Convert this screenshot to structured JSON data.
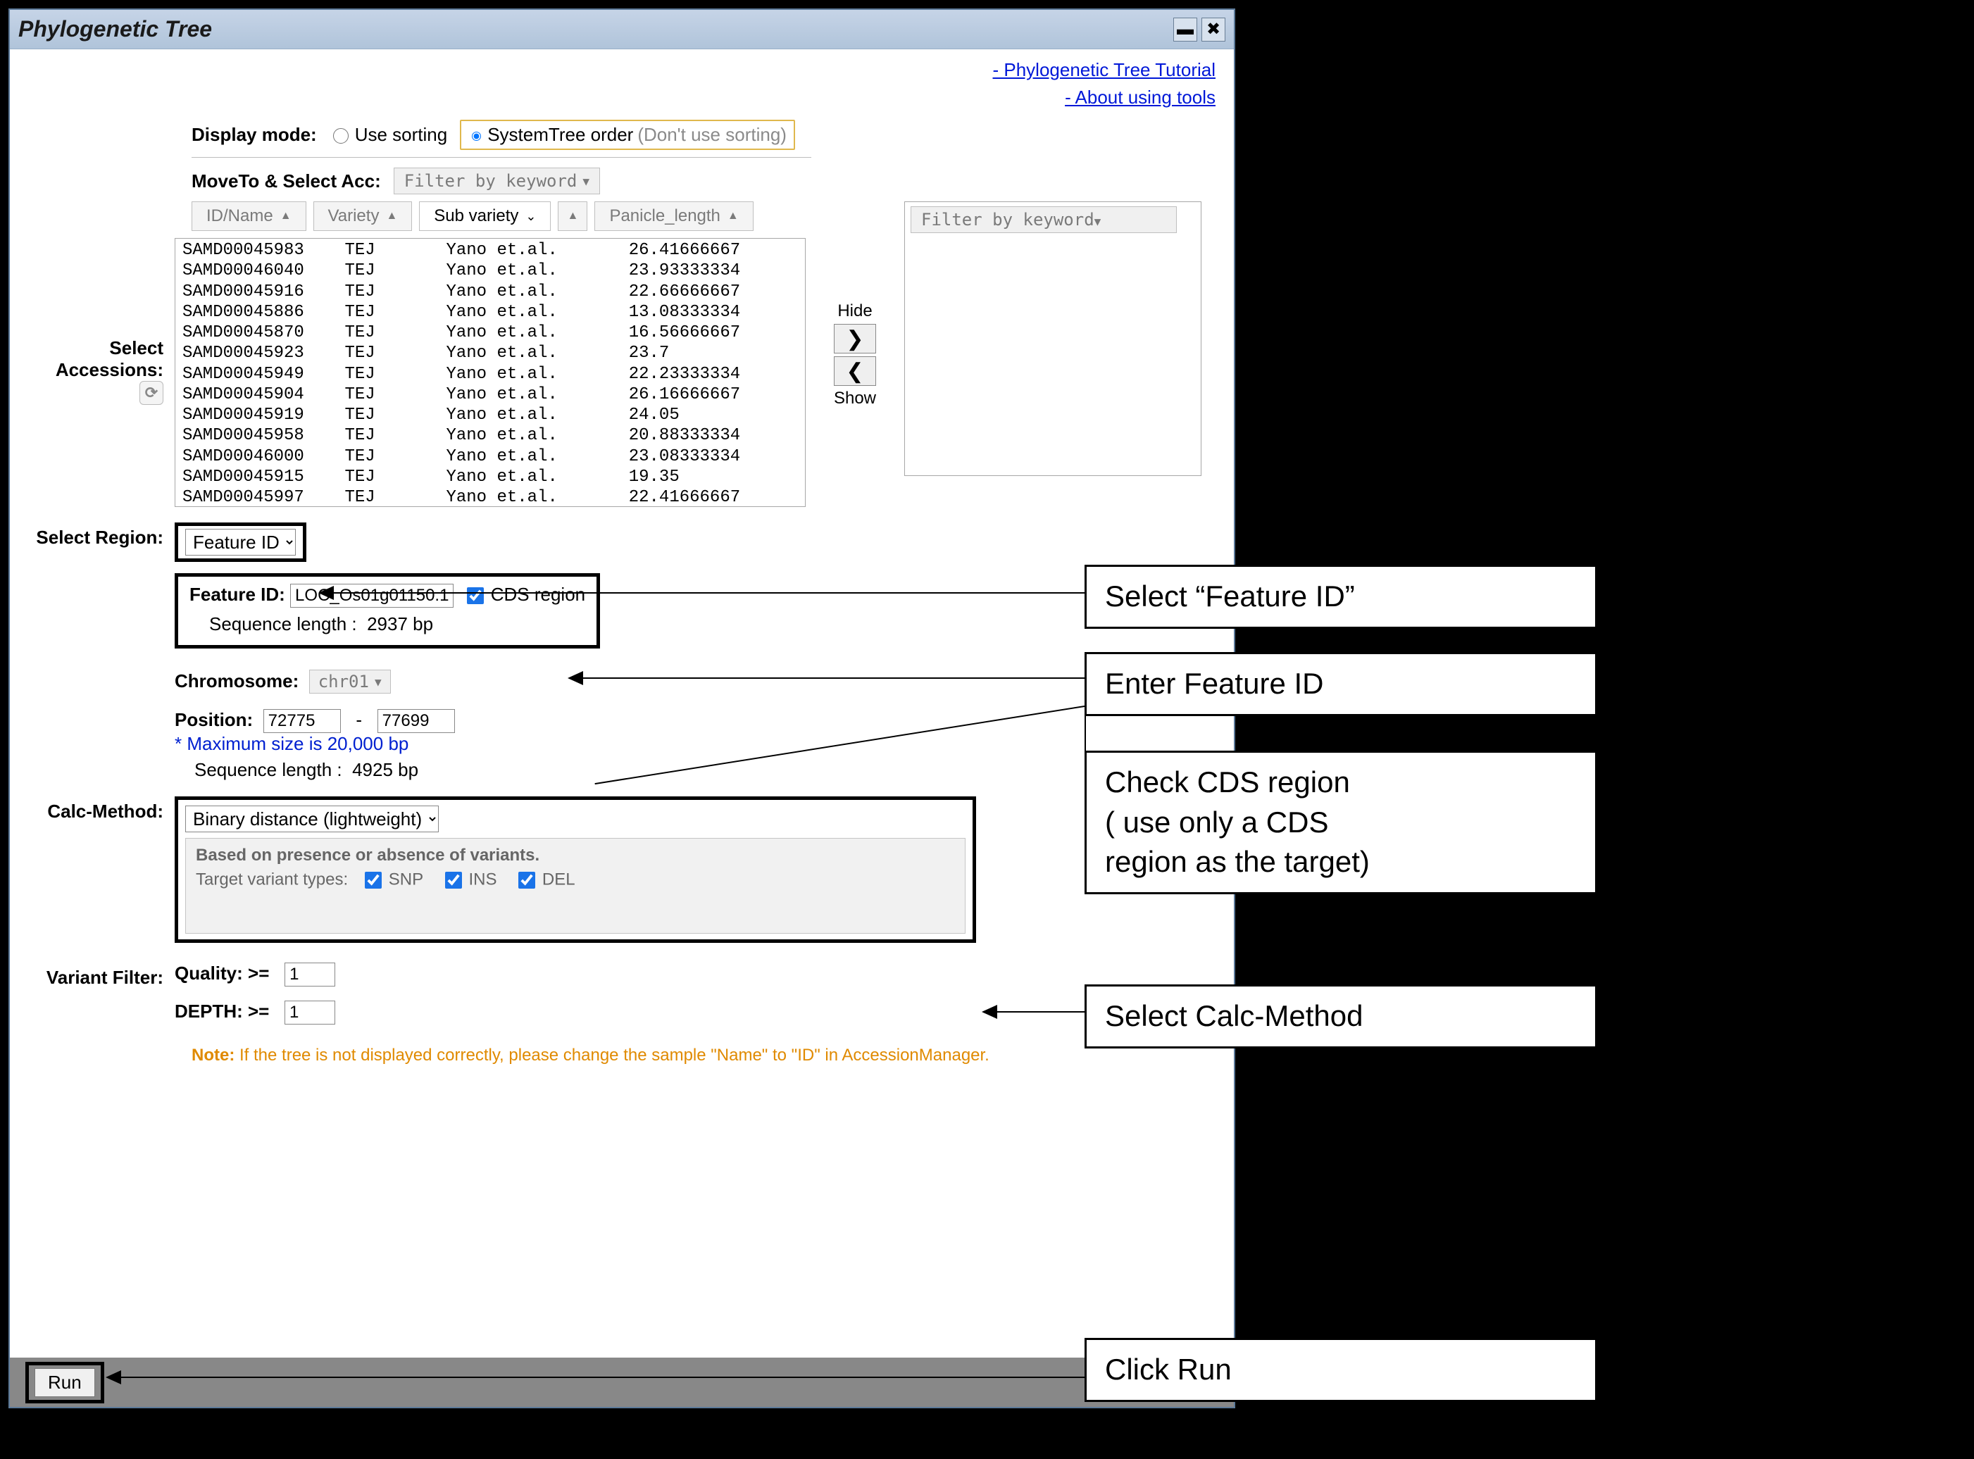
{
  "window": {
    "title": "Phylogenetic Tree"
  },
  "links": {
    "tutorial": "- Phylogenetic Tree Tutorial",
    "about": "- About using tools"
  },
  "display_mode": {
    "label": "Display mode:",
    "use_sorting": "Use sorting",
    "system_tree": "SystemTree order",
    "system_tree_hint": "(Don't use sorting)",
    "selected": "system_tree"
  },
  "moveto": {
    "label": "MoveTo & Select Acc:",
    "filter_placeholder": "Filter by keyword"
  },
  "accessions": {
    "section_label": "Select\nAccessions:",
    "columns": [
      {
        "name": "id",
        "label": "ID/Name",
        "active": false
      },
      {
        "name": "variety",
        "label": "Variety",
        "active": false
      },
      {
        "name": "subvariety",
        "label": "Sub variety",
        "active": true
      },
      {
        "name": "panicle",
        "label": "Panicle_length",
        "active": false
      }
    ],
    "rows": [
      {
        "id": "SAMD00045983",
        "variety": "TEJ",
        "sub": "Yano et.al.",
        "pl": "26.41666667"
      },
      {
        "id": "SAMD00046040",
        "variety": "TEJ",
        "sub": "Yano et.al.",
        "pl": "23.93333334"
      },
      {
        "id": "SAMD00045916",
        "variety": "TEJ",
        "sub": "Yano et.al.",
        "pl": "22.66666667"
      },
      {
        "id": "SAMD00045886",
        "variety": "TEJ",
        "sub": "Yano et.al.",
        "pl": "13.08333334"
      },
      {
        "id": "SAMD00045870",
        "variety": "TEJ",
        "sub": "Yano et.al.",
        "pl": "16.56666667"
      },
      {
        "id": "SAMD00045923",
        "variety": "TEJ",
        "sub": "Yano et.al.",
        "pl": "23.7"
      },
      {
        "id": "SAMD00045949",
        "variety": "TEJ",
        "sub": "Yano et.al.",
        "pl": "22.23333334"
      },
      {
        "id": "SAMD00045904",
        "variety": "TEJ",
        "sub": "Yano et.al.",
        "pl": "26.16666667"
      },
      {
        "id": "SAMD00045919",
        "variety": "TEJ",
        "sub": "Yano et.al.",
        "pl": "24.05"
      },
      {
        "id": "SAMD00045958",
        "variety": "TEJ",
        "sub": "Yano et.al.",
        "pl": "20.88333334"
      },
      {
        "id": "SAMD00046000",
        "variety": "TEJ",
        "sub": "Yano et.al.",
        "pl": "23.08333334"
      },
      {
        "id": "SAMD00045915",
        "variety": "TEJ",
        "sub": "Yano et.al.",
        "pl": "19.35"
      },
      {
        "id": "SAMD00045997",
        "variety": "TEJ",
        "sub": "Yano et.al.",
        "pl": "22.41666667"
      }
    ],
    "hide_label": "Hide",
    "show_label": "Show",
    "right_filter_placeholder": "Filter by keyword"
  },
  "region": {
    "section_label": "Select Region:",
    "mode_value": "Feature ID",
    "feature_id_label": "Feature ID:",
    "feature_id_value": "LOC_Os01g01150.1",
    "cds_label": "CDS region",
    "seq_len_label": "Sequence length :",
    "seq_len_value": "2937 bp",
    "chrom_label": "Chromosome:",
    "chrom_value": "chr01",
    "pos_label": "Position:",
    "pos_from": "72775",
    "pos_to": "77699",
    "pos_note": "* Maximum size is 20,000 bp",
    "seq_len2_value": "4925 bp"
  },
  "calc": {
    "section_label": "Calc-Method:",
    "method_value": "Binary distance (lightweight)",
    "desc_header": "Based on presence or absence of variants.",
    "tvt_label": "Target variant types:",
    "snp": "SNP",
    "ins": "INS",
    "del": "DEL"
  },
  "filter": {
    "section_label": "Variant Filter:",
    "quality_label": "Quality:  >=",
    "quality_value": "1",
    "depth_label": "DEPTH:  >=",
    "depth_value": "1"
  },
  "note": {
    "label": "Note:",
    "text": "If the tree is not displayed correctly, please change the sample \"Name\" to \"ID\" in AccessionManager."
  },
  "footer": {
    "run": "Run"
  },
  "callouts": {
    "c1": "Select “Feature ID”",
    "c2": "Enter Feature ID",
    "c3": "Check CDS region\n( use only a CDS \nregion as the target)",
    "c4": "Select Calc-Method",
    "c5": "Click Run"
  }
}
